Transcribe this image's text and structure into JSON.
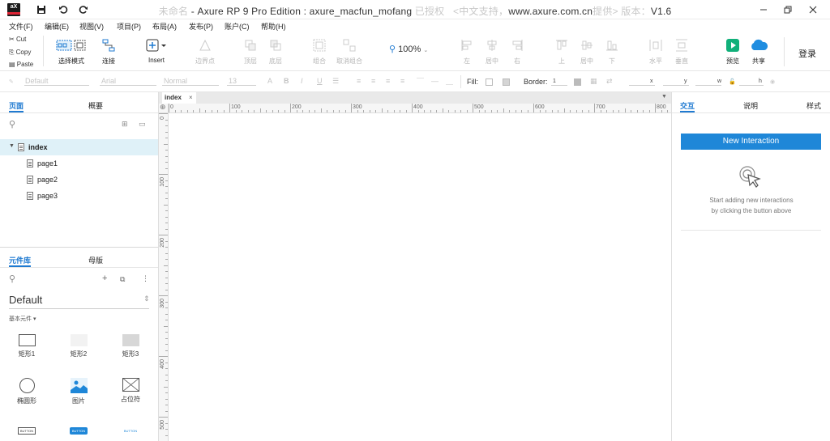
{
  "app": {
    "logo_text": "aX",
    "title_ghost_left": "未命名",
    "title_main": "Axure RP 9 Pro Edition : axure_macfun_mofang",
    "title_ghost_mid": "已授权",
    "title_ghost_mid2": "<中文支持，",
    "title_url": "www.axure.com.cn",
    "title_ghost_right": "提供> 版本：",
    "title_version": "V1.6"
  },
  "menu": [
    "文件(F)",
    "编辑(E)",
    "视图(V)",
    "项目(P)",
    "布局(A)",
    "发布(P)",
    "账户(C)",
    "帮助(H)"
  ],
  "clipboard": {
    "cut": "Cut",
    "copy": "Copy",
    "paste": "Paste"
  },
  "toolbar": {
    "select_mode": "选择模式",
    "connect": "连接",
    "insert": "Insert",
    "boundary": "边界点",
    "top": "顶层",
    "bottom": "底层",
    "group": "组合",
    "ungroup": "取消组合",
    "zoom": "100%",
    "left": "左",
    "center": "居中",
    "right": "右",
    "up": "上",
    "middle": "居中",
    "down": "下",
    "horizontal": "水平",
    "vertical": "垂直",
    "preview": "预览",
    "share": "共享",
    "login": "登录"
  },
  "formatbar": {
    "style": "Default",
    "font": "Arial",
    "weight": "Normal",
    "size": "13",
    "fill_label": "Fill:",
    "border_label": "Border:",
    "border_value": "1",
    "x": "x",
    "y": "y",
    "w": "w",
    "h": "h"
  },
  "left": {
    "tabs": [
      "页面",
      "概要"
    ],
    "pages": [
      {
        "name": "index",
        "level": 0
      },
      {
        "name": "page1",
        "level": 1
      },
      {
        "name": "page2",
        "level": 1
      },
      {
        "name": "page3",
        "level": 1
      }
    ],
    "lib_tabs": [
      "元件库",
      "母版"
    ],
    "library_name": "Default",
    "category": "基本元件 ▾",
    "widgets": [
      "矩形1",
      "矩形2",
      "矩形3",
      "椭圆形",
      "图片",
      "占位符"
    ],
    "buttons": [
      "BUTTON",
      "BUTTON",
      "BUTTON"
    ]
  },
  "canvas": {
    "tab": "index",
    "h_ticks": [
      "0",
      "100",
      "200",
      "300",
      "400",
      "500",
      "600",
      "700",
      "800"
    ],
    "v_ticks": [
      "0",
      "100",
      "200",
      "300",
      "400",
      "500"
    ]
  },
  "right": {
    "tabs": [
      "交互",
      "说明",
      "样式"
    ],
    "new_interaction": "New Interaction",
    "hint1": "Start adding new interactions",
    "hint2": "by clicking the button above"
  },
  "colors": {
    "accent": "#1f7ad1",
    "button": "#1f87d8",
    "preview": "#11b07a",
    "share": "#1f8de0"
  }
}
